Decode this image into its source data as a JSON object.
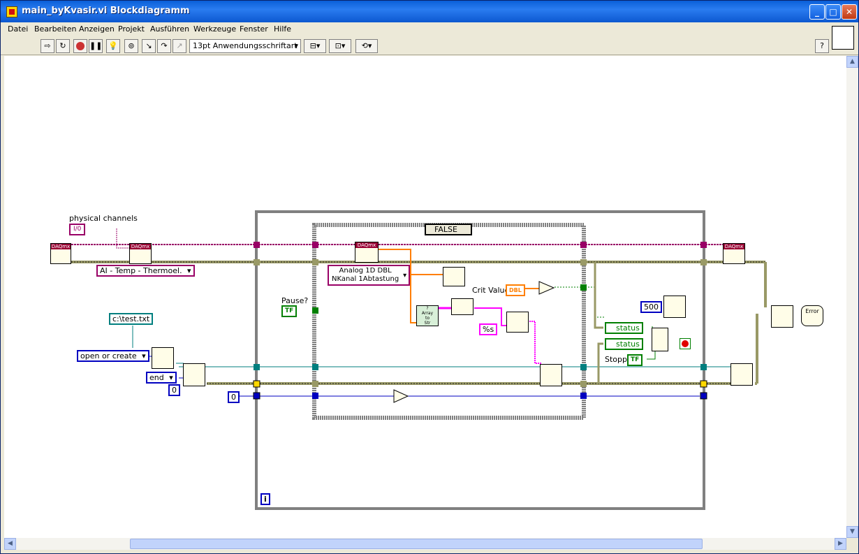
{
  "window": {
    "title": "main_byKvasir.vi Blockdiagramm"
  },
  "menu": [
    "Datei",
    "Bearbeiten",
    "Anzeigen",
    "Projekt",
    "Ausführen",
    "Werkzeuge",
    "Fenster",
    "Hilfe"
  ],
  "toolbar": {
    "font_select": "13pt Anwendungsschriftart",
    "help": "?"
  },
  "diagram": {
    "physical_channels_label": "physical channels",
    "io_const": "I/0",
    "ai_type": "AI - Temp - Thermoel.",
    "filepath": "c:\\test.txt",
    "open_mode": "open or create",
    "seek_mode": "end",
    "seek_offset": "0",
    "iter_init": "0",
    "pause_label": "Pause?",
    "pause_tf": "TF",
    "case_selector": "FALSE",
    "daqmx_read_poly": [
      "Analog 1D DBL",
      "NKanal 1Abtastung"
    ],
    "crit_value_label": "Crit Value",
    "crit_value_type": "DBL",
    "array_to_str": [
      "?",
      "Array",
      "to",
      "Str"
    ],
    "format_const": "%s",
    "wait_ms": "500",
    "status1": "status",
    "status2": "status",
    "stop_label": "Stopp",
    "stop_tf": "TF",
    "loop_iter": "i",
    "daqmx_tag": "DAQmx",
    "error_label": "Error"
  },
  "colors": {
    "error_cluster": "#999966",
    "task_wire": "#990066",
    "file_ref": "#007f7f",
    "int_wire": "#0000c0",
    "string_wire": "#ff00ff",
    "bool_wire": "#007f00",
    "dbl_wire": "#ff7f00"
  }
}
